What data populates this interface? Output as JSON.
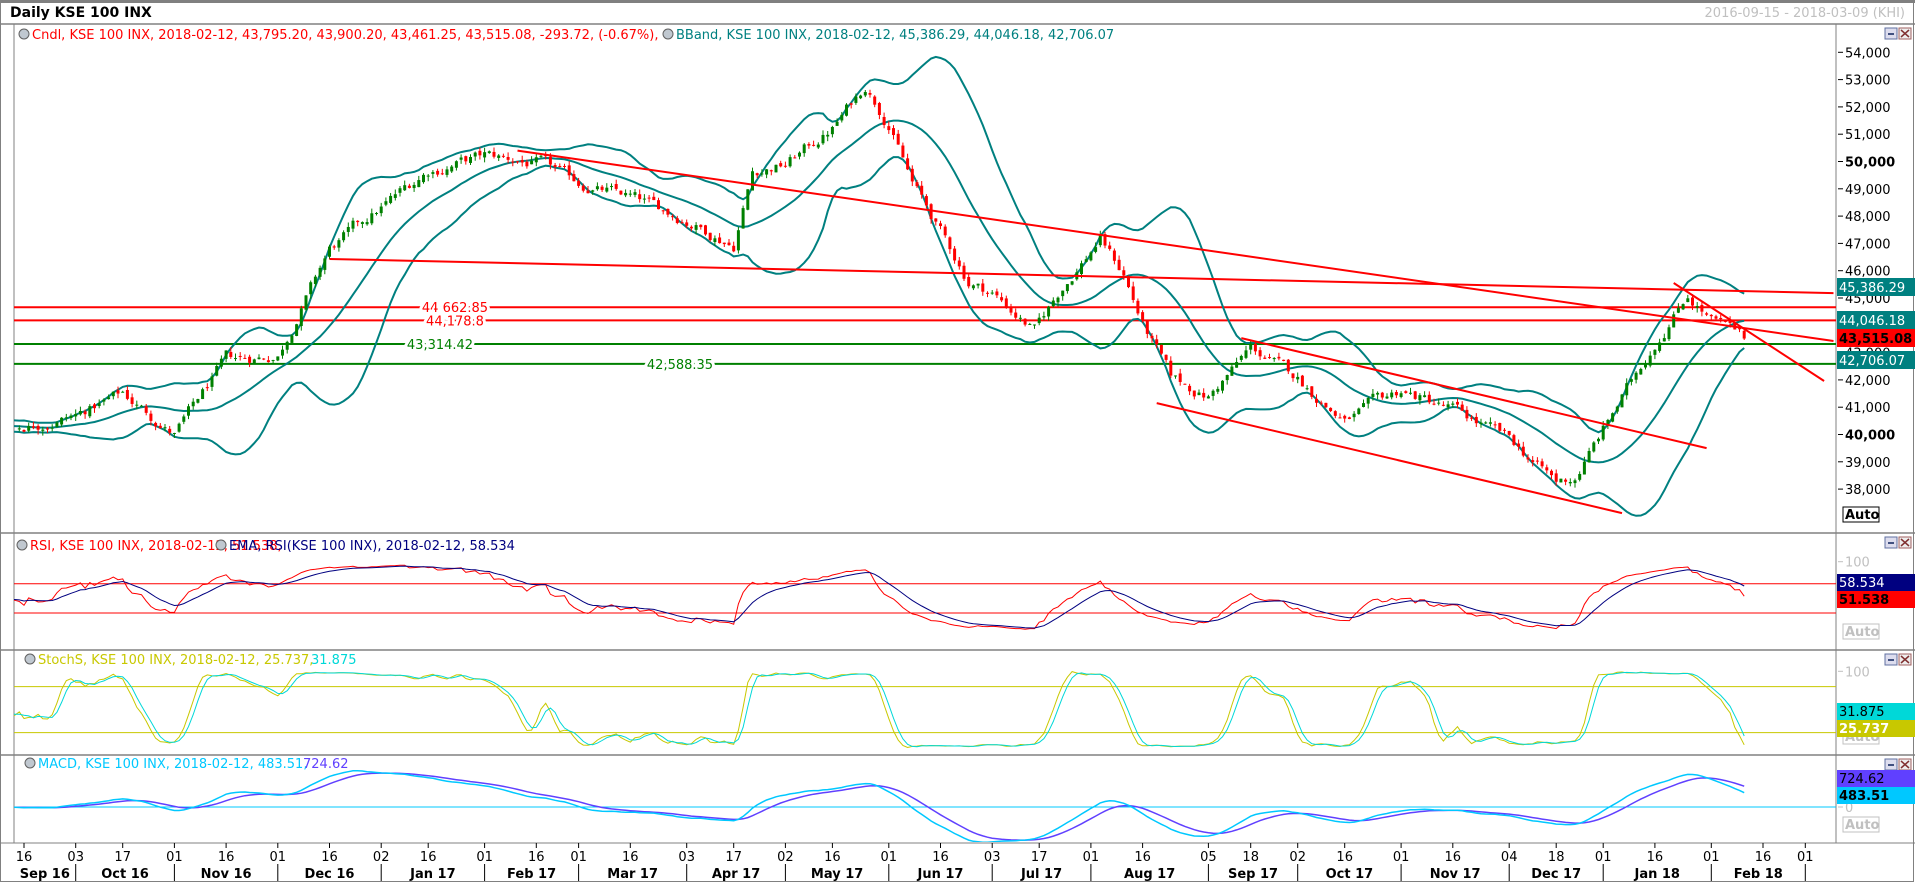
{
  "window": {
    "title": "Daily KSE 100 INX",
    "range": "2016-09-15 - 2018-03-09 (KHI)",
    "minimize_icon": "minimize-icon",
    "close_icon": "close-icon",
    "auto_label": "Auto"
  },
  "legends": {
    "candle": "Cndl, KSE 100 INX, 2018-02-12, 43,795.20, 43,900.20, 43,461.25, 43,515.08, -293.72, (-0.67%),",
    "bband": "BBand, KSE 100 INX, 2018-02-12, 45,386.29, 44,046.18, 42,706.07",
    "rsi": "RSI, KSE 100 INX, 2018-02-12, 51.538,",
    "ema": "EMA, RSI(KSE 100 INX), 2018-02-12, 58.534",
    "stoch_a": "StochS, KSE 100 INX, 2018-02-12, 25.737,",
    "stoch_b": "31.875",
    "macd_a": "MACD, KSE 100 INX, 2018-02-12, 483.51,",
    "macd_b": "724.62"
  },
  "value_tags": {
    "bb_upper": "45,386.29",
    "bb_mid": "44,046.18",
    "close": "43,515.08",
    "bb_lower": "42,706.07",
    "ema": "58.534",
    "rsi": "51.538",
    "stoch_d": "31.875",
    "stoch_k": "25.737",
    "macd_signal": "724.62",
    "macd": "483.51"
  },
  "colors": {
    "up": "#008000",
    "down": "#ff0000",
    "bband": "#008080",
    "rsi": "#ff0000",
    "ema": "#000080",
    "stoch_k": "#c8c800",
    "stoch_d": "#00d8d8",
    "macd": "#00c8ff",
    "signal": "#6040ff",
    "level_red": "#ff0000",
    "level_green": "#008000"
  },
  "chart_data": {
    "type": "candlestick",
    "title": "Daily KSE 100 INX",
    "last_bar": {
      "date": "2018-02-12",
      "open": 43795.2,
      "high": 43900.2,
      "low": 43461.25,
      "close": 43515.08,
      "change": -293.72,
      "change_pct": -0.67
    },
    "price_axis": {
      "ylim": [
        37400,
        54600
      ],
      "ticks": [
        "54,000",
        "53,000",
        "52,000",
        "51,000",
        "50,000",
        "49,000",
        "48,000",
        "47,000",
        "46,000",
        "45,000",
        "44,000",
        "43,000",
        "42,000",
        "41,000",
        "40,000",
        "39,000",
        "38,000"
      ],
      "tick_values": [
        54000,
        53000,
        52000,
        51000,
        50000,
        49000,
        48000,
        47000,
        46000,
        45000,
        44000,
        43000,
        42000,
        41000,
        40000,
        39000,
        38000
      ],
      "bold": [
        50000,
        40000
      ]
    },
    "close_keypoints": [
      [
        "2016-09-16",
        40330
      ],
      [
        "2016-10-03",
        40700
      ],
      [
        "2016-10-17",
        41500
      ],
      [
        "2016-11-01",
        40000
      ],
      [
        "2016-11-16",
        42700
      ],
      [
        "2016-12-01",
        42900
      ],
      [
        "2016-12-16",
        46750
      ],
      [
        "2017-01-02",
        48300
      ],
      [
        "2017-01-16",
        49650
      ],
      [
        "2017-02-01",
        50200
      ],
      [
        "2017-02-17",
        49900
      ],
      [
        "2017-03-01",
        49200
      ],
      [
        "2017-03-16",
        48670
      ],
      [
        "2017-04-03",
        47860
      ],
      [
        "2017-04-17",
        46960
      ],
      [
        "2017-04-21",
        49650
      ],
      [
        "2017-05-02",
        49900
      ],
      [
        "2017-05-16",
        51200
      ],
      [
        "2017-05-25",
        52800
      ],
      [
        "2017-06-01",
        51450
      ],
      [
        "2017-06-08",
        49200
      ],
      [
        "2017-06-16",
        47400
      ],
      [
        "2017-06-26",
        45600
      ],
      [
        "2017-07-03",
        45200
      ],
      [
        "2017-07-14",
        43800
      ],
      [
        "2017-07-24",
        45400
      ],
      [
        "2017-08-03",
        47200
      ],
      [
        "2017-08-10",
        45850
      ],
      [
        "2017-08-16",
        44050
      ],
      [
        "2017-08-24",
        42050
      ],
      [
        "2017-09-05",
        41370
      ],
      [
        "2017-09-18",
        43160
      ],
      [
        "2017-10-02",
        42050
      ],
      [
        "2017-10-16",
        40470
      ],
      [
        "2017-11-01",
        41600
      ],
      [
        "2017-11-16",
        40900
      ],
      [
        "2017-12-04",
        39800
      ],
      [
        "2017-12-18",
        38230
      ],
      [
        "2017-12-22",
        38400
      ],
      [
        "2018-01-02",
        40470
      ],
      [
        "2018-01-16",
        43380
      ],
      [
        "2018-01-25",
        45170
      ],
      [
        "2018-02-01",
        44190
      ],
      [
        "2018-02-12",
        43515
      ]
    ],
    "horizontal_levels": [
      {
        "value": 44662.85,
        "label": "44,662.85",
        "color": "red"
      },
      {
        "value": 44178.8,
        "label": "44,178.8",
        "color": "red"
      },
      {
        "value": 43314.42,
        "label": "43,314.42",
        "color": "green"
      },
      {
        "value": 42588.35,
        "label": "42,588.35",
        "color": "green"
      }
    ],
    "trendlines": [
      {
        "from": [
          "2016-12-16",
          46430
        ],
        "to": [
          "2018-03-09",
          45180
        ]
      },
      {
        "from": [
          "2017-02-10",
          50400
        ],
        "to": [
          "2018-03-09",
          43425
        ]
      },
      {
        "from": [
          "2018-01-22",
          45550
        ],
        "to": [
          "2018-03-07",
          41960
        ]
      },
      {
        "from": [
          "2017-09-14",
          43530
        ],
        "to": [
          "2018-01-31",
          39500
        ]
      },
      {
        "from": [
          "2017-08-21",
          41150
        ],
        "to": [
          "2018-01-05",
          37120
        ]
      }
    ],
    "indicators": {
      "bband": {
        "period": 20,
        "stdev": 2
      },
      "rsi": {
        "period": 14,
        "ema": 9,
        "levels": [
          70,
          30
        ],
        "axis_tick": "100"
      },
      "stoch": {
        "k": 14,
        "smooth": 3,
        "d": 3,
        "levels": [
          80,
          20
        ],
        "axis_tick": "100"
      },
      "macd": {
        "fast": 12,
        "slow": 26,
        "signal": 9,
        "axis_tick": "0"
      }
    },
    "x_axis": {
      "start": "2016-09-15",
      "end": "2018-03-09",
      "ticks": [
        [
          "2016-09-16",
          "16"
        ],
        [
          "2016-10-03",
          "03"
        ],
        [
          "2016-10-17",
          "17"
        ],
        [
          "2016-11-01",
          "01"
        ],
        [
          "2016-11-16",
          "16"
        ],
        [
          "2016-12-01",
          "01"
        ],
        [
          "2016-12-16",
          "16"
        ],
        [
          "2017-01-02",
          "02"
        ],
        [
          "2017-01-16",
          "16"
        ],
        [
          "2017-02-01",
          "01"
        ],
        [
          "2017-02-16",
          "16"
        ],
        [
          "2017-03-01",
          "01"
        ],
        [
          "2017-03-16",
          "16"
        ],
        [
          "2017-04-03",
          "03"
        ],
        [
          "2017-04-17",
          "17"
        ],
        [
          "2017-05-02",
          "02"
        ],
        [
          "2017-05-16",
          "16"
        ],
        [
          "2017-06-01",
          "01"
        ],
        [
          "2017-06-16",
          "16"
        ],
        [
          "2017-07-03",
          "03"
        ],
        [
          "2017-07-17",
          "17"
        ],
        [
          "2017-08-01",
          "01"
        ],
        [
          "2017-08-16",
          "16"
        ],
        [
          "2017-09-05",
          "05"
        ],
        [
          "2017-09-18",
          "18"
        ],
        [
          "2017-10-02",
          "02"
        ],
        [
          "2017-10-16",
          "16"
        ],
        [
          "2017-11-01",
          "01"
        ],
        [
          "2017-11-16",
          "16"
        ],
        [
          "2017-12-04",
          "04"
        ],
        [
          "2017-12-18",
          "18"
        ],
        [
          "2018-01-01",
          "01"
        ],
        [
          "2018-01-16",
          "16"
        ],
        [
          "2018-02-01",
          "01"
        ],
        [
          "2018-02-16",
          "16"
        ],
        [
          "2018-03-01",
          "01"
        ]
      ],
      "months": [
        [
          "2016-09-15",
          "Sep 16"
        ],
        [
          "2016-10-03",
          "Oct 16"
        ],
        [
          "2016-11-01",
          "Nov 16"
        ],
        [
          "2016-12-01",
          "Dec 16"
        ],
        [
          "2017-01-02",
          "Jan 17"
        ],
        [
          "2017-02-01",
          "Feb 17"
        ],
        [
          "2017-03-01",
          "Mar 17"
        ],
        [
          "2017-04-03",
          "Apr 17"
        ],
        [
          "2017-05-02",
          "May 17"
        ],
        [
          "2017-06-01",
          "Jun 17"
        ],
        [
          "2017-07-03",
          "Jul 17"
        ],
        [
          "2017-08-01",
          "Aug 17"
        ],
        [
          "2017-09-05",
          "Sep 17"
        ],
        [
          "2017-10-02",
          "Oct 17"
        ],
        [
          "2017-11-01",
          "Nov 17"
        ],
        [
          "2017-12-04",
          "Dec 17"
        ],
        [
          "2018-01-01",
          "Jan 18"
        ],
        [
          "2018-02-01",
          "Feb 18"
        ],
        [
          "2018-03-01",
          ""
        ]
      ]
    }
  }
}
